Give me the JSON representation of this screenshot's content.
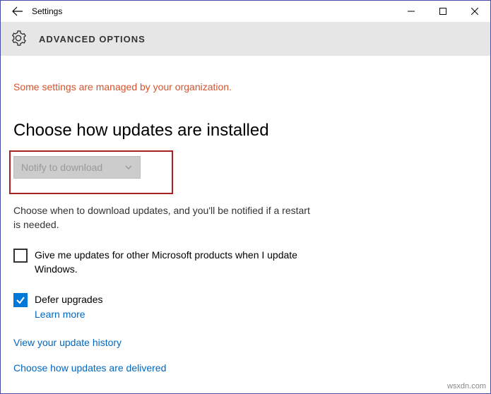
{
  "titlebar": {
    "title": "Settings"
  },
  "header": {
    "page_title": "ADVANCED OPTIONS"
  },
  "content": {
    "org_notice": "Some settings are managed by your organization.",
    "section_title": "Choose how updates are installed",
    "dropdown_value": "Notify to download",
    "desc": "Choose when to download updates, and you'll be notified if a restart is needed.",
    "cb_other_products": "Give me updates for other Microsoft products when I update Windows.",
    "cb_defer": "Defer upgrades",
    "learn_more": "Learn more",
    "link_history": "View your update history",
    "link_delivered": "Choose how updates are delivered"
  },
  "watermark": "wsxdn.com"
}
